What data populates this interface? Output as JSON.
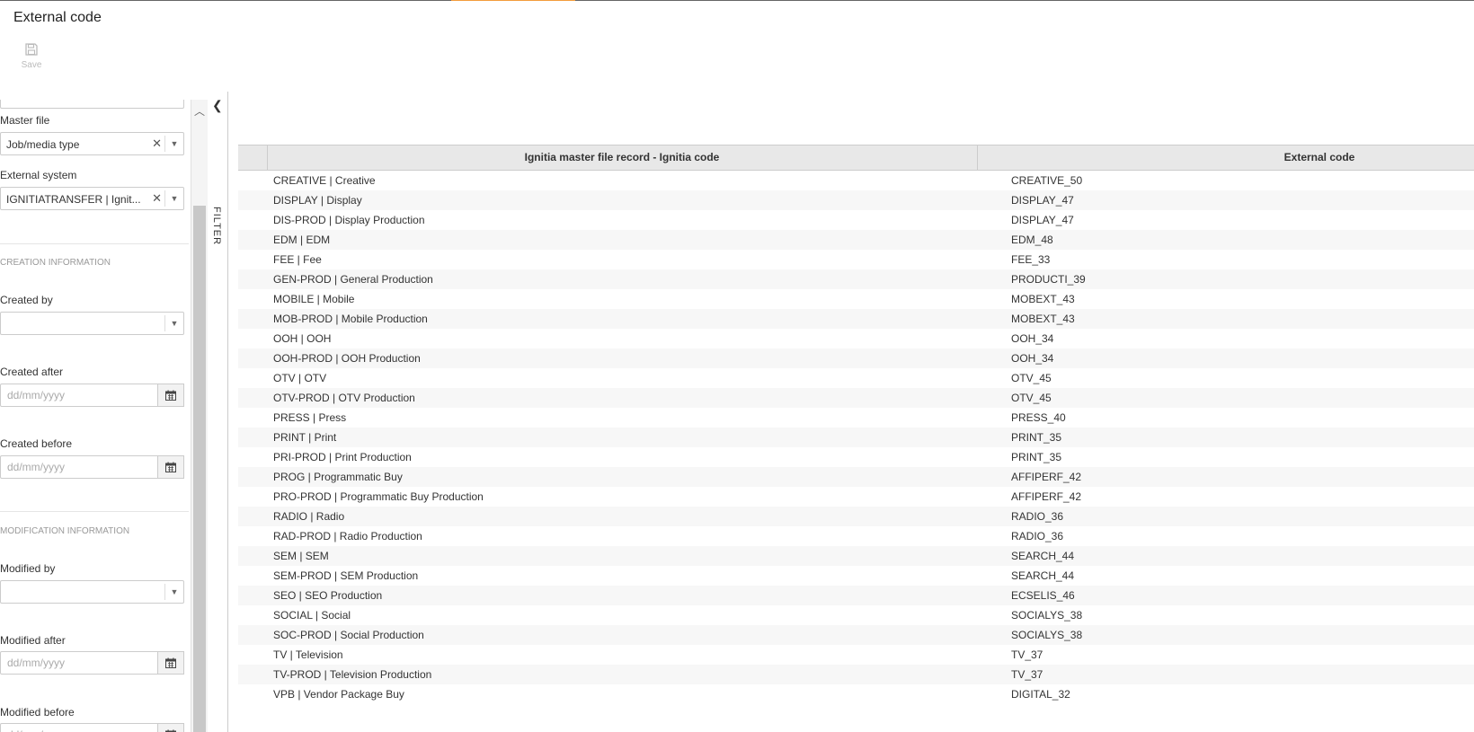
{
  "header": {
    "title": "External code",
    "save_label": "Save"
  },
  "filters": {
    "master_file": {
      "label": "Master file",
      "value": "Job/media type"
    },
    "external_system": {
      "label": "External system",
      "value": "IGNITIATRANSFER | Ignit..."
    },
    "creation_section": "CREATION INFORMATION",
    "created_by": {
      "label": "Created by",
      "value": ""
    },
    "created_after": {
      "label": "Created after",
      "placeholder": "dd/mm/yyyy"
    },
    "created_before": {
      "label": "Created before",
      "placeholder": "dd/mm/yyyy"
    },
    "modification_section": "MODIFICATION INFORMATION",
    "modified_by": {
      "label": "Modified by",
      "value": ""
    },
    "modified_after": {
      "label": "Modified after",
      "placeholder": "dd/mm/yyyy"
    },
    "modified_before": {
      "label": "Modified before",
      "placeholder": "dd/mm/yyyy"
    },
    "toggle_label": "FILTER"
  },
  "grid": {
    "columns": [
      "Ignitia master file record - Ignitia code",
      "External code"
    ],
    "rows": [
      [
        "CREATIVE | Creative",
        "CREATIVE_50"
      ],
      [
        "DISPLAY | Display",
        "DISPLAY_47"
      ],
      [
        "DIS-PROD | Display Production",
        "DISPLAY_47"
      ],
      [
        "EDM | EDM",
        "EDM_48"
      ],
      [
        "FEE | Fee",
        "FEE_33"
      ],
      [
        "GEN-PROD | General Production",
        "PRODUCTI_39"
      ],
      [
        "MOBILE | Mobile",
        "MOBEXT_43"
      ],
      [
        "MOB-PROD | Mobile Production",
        "MOBEXT_43"
      ],
      [
        "OOH | OOH",
        "OOH_34"
      ],
      [
        "OOH-PROD | OOH Production",
        "OOH_34"
      ],
      [
        "OTV | OTV",
        "OTV_45"
      ],
      [
        "OTV-PROD | OTV Production",
        "OTV_45"
      ],
      [
        "PRESS | Press",
        "PRESS_40"
      ],
      [
        "PRINT | Print",
        "PRINT_35"
      ],
      [
        "PRI-PROD | Print Production",
        "PRINT_35"
      ],
      [
        "PROG | Programmatic Buy",
        "AFFIPERF_42"
      ],
      [
        "PRO-PROD | Programmatic Buy Production",
        "AFFIPERF_42"
      ],
      [
        "RADIO | Radio",
        "RADIO_36"
      ],
      [
        "RAD-PROD | Radio Production",
        "RADIO_36"
      ],
      [
        "SEM | SEM",
        "SEARCH_44"
      ],
      [
        "SEM-PROD | SEM Production",
        "SEARCH_44"
      ],
      [
        "SEO | SEO Production",
        "ECSELIS_46"
      ],
      [
        "SOCIAL | Social",
        "SOCIALYS_38"
      ],
      [
        "SOC-PROD | Social Production",
        "SOCIALYS_38"
      ],
      [
        "TV | Television",
        "TV_37"
      ],
      [
        "TV-PROD | Television Production",
        "TV_37"
      ],
      [
        "VPB | Vendor Package Buy",
        "DIGITAL_32"
      ]
    ]
  },
  "colors": {
    "accent": "#f39c3c",
    "header_bg": "#e8e8e8",
    "stripe": "#f7f7f7"
  }
}
